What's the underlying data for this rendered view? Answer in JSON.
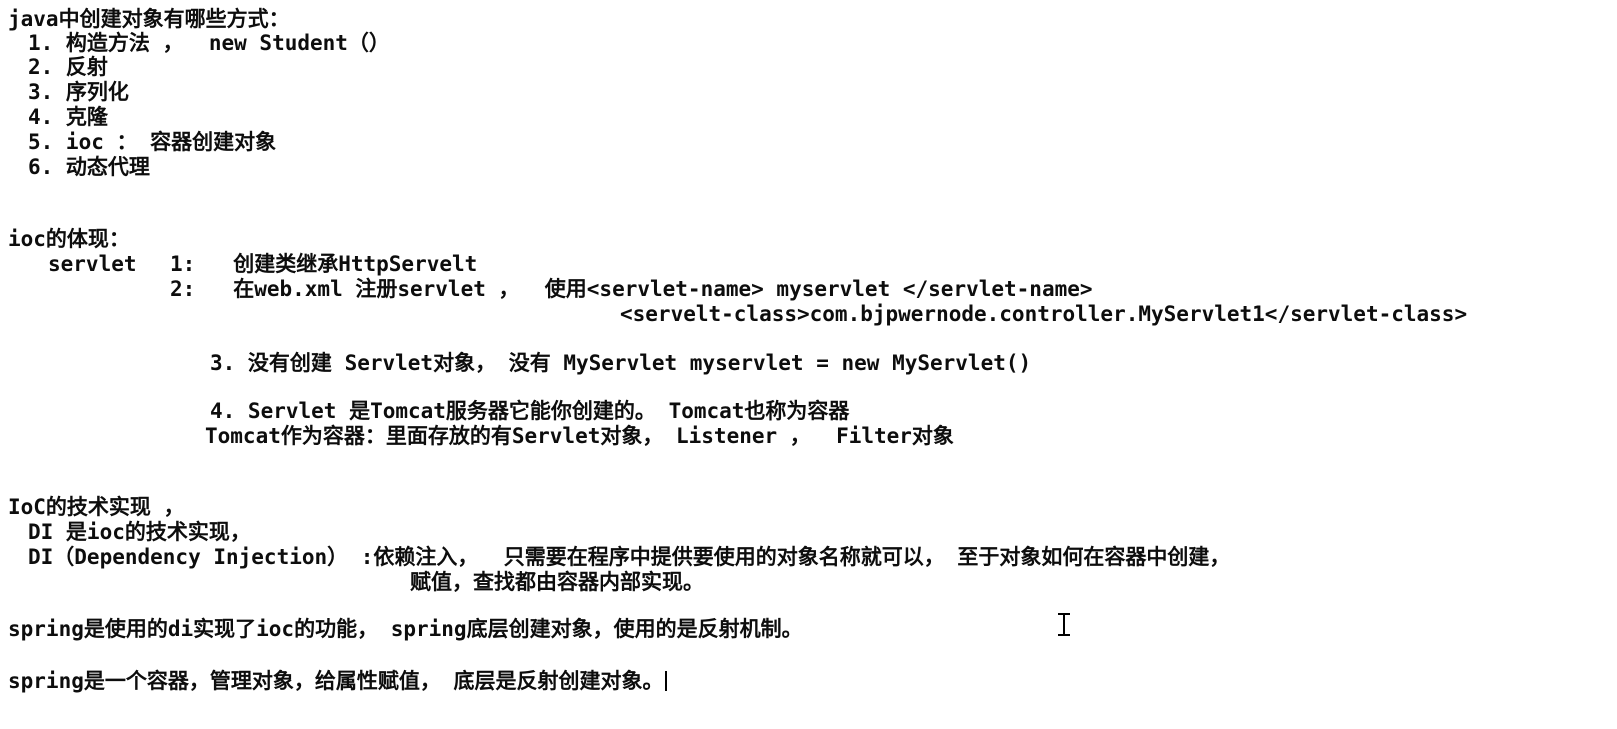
{
  "document": {
    "section_object_creation": {
      "heading": "java中创建对象有哪些方式：",
      "items": [
        "1. 构造方法 ，  new Student（）",
        "2. 反射",
        "3. 序列化",
        "4. 克隆",
        "5. ioc ： 容器创建对象",
        "6. 动态代理"
      ]
    },
    "section_ioc_manifestation": {
      "heading": "ioc的体现：",
      "servlet_label": "servlet",
      "step1": "1:   创建类继承HttpServelt",
      "step2": "2:   在web.xml 注册servlet ，  使用<servlet-name> myservlet </servlet-name>",
      "step2_cont": "<servelt-class>com.bjpwernode.controller.MyServlet1</servlet-class>",
      "step3": "3. 没有创建 Servlet对象， 没有 MyServlet myservlet = new MyServlet()",
      "step4": "4. Servlet 是Tomcat服务器它能你创建的。 Tomcat也称为容器",
      "step4_cont": "Tomcat作为容器：里面存放的有Servlet对象， Listener ，  Filter对象"
    },
    "section_ioc_technique": {
      "heading": "IoC的技术实现 ，",
      "di_line1": "DI 是ioc的技术实现，",
      "di_line2": "DI（Dependency Injection） :依赖注入，  只需要在程序中提供要使用的对象名称就可以， 至于对象如何在容器中创建，",
      "di_line2_cont": "赋值，查找都由容器内部实现。"
    },
    "section_spring": {
      "line1": "spring是使用的di实现了ioc的功能， spring底层创建对象，使用的是反射机制。",
      "line2": "spring是一个容器，管理对象，给属性赋值， 底层是反射创建对象。"
    },
    "cursor": {
      "text_caret": "|",
      "mouse_pointer": "i-beam-cursor"
    },
    "colors": {
      "background": "#ffffff",
      "text": "#0d0d0d"
    }
  }
}
